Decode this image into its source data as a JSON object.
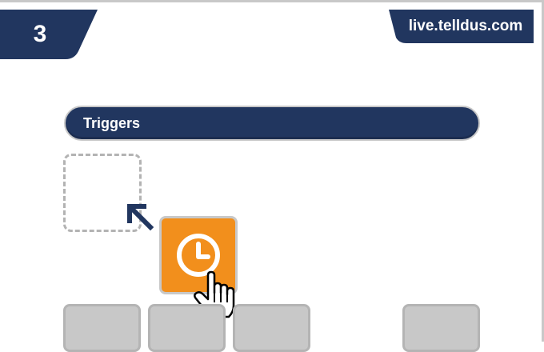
{
  "step": {
    "number": "3"
  },
  "header": {
    "url": "live.telldus.com"
  },
  "section": {
    "title": "Triggers"
  },
  "colors": {
    "navy": "#21365f",
    "orange": "#f28f1c",
    "tile_gray": "#c8c8c8",
    "dashed_gray": "#b3b3b3"
  },
  "icons": {
    "trigger": "clock-icon",
    "cursor": "hand-pointer-icon",
    "direction": "arrow-up-left-icon"
  }
}
